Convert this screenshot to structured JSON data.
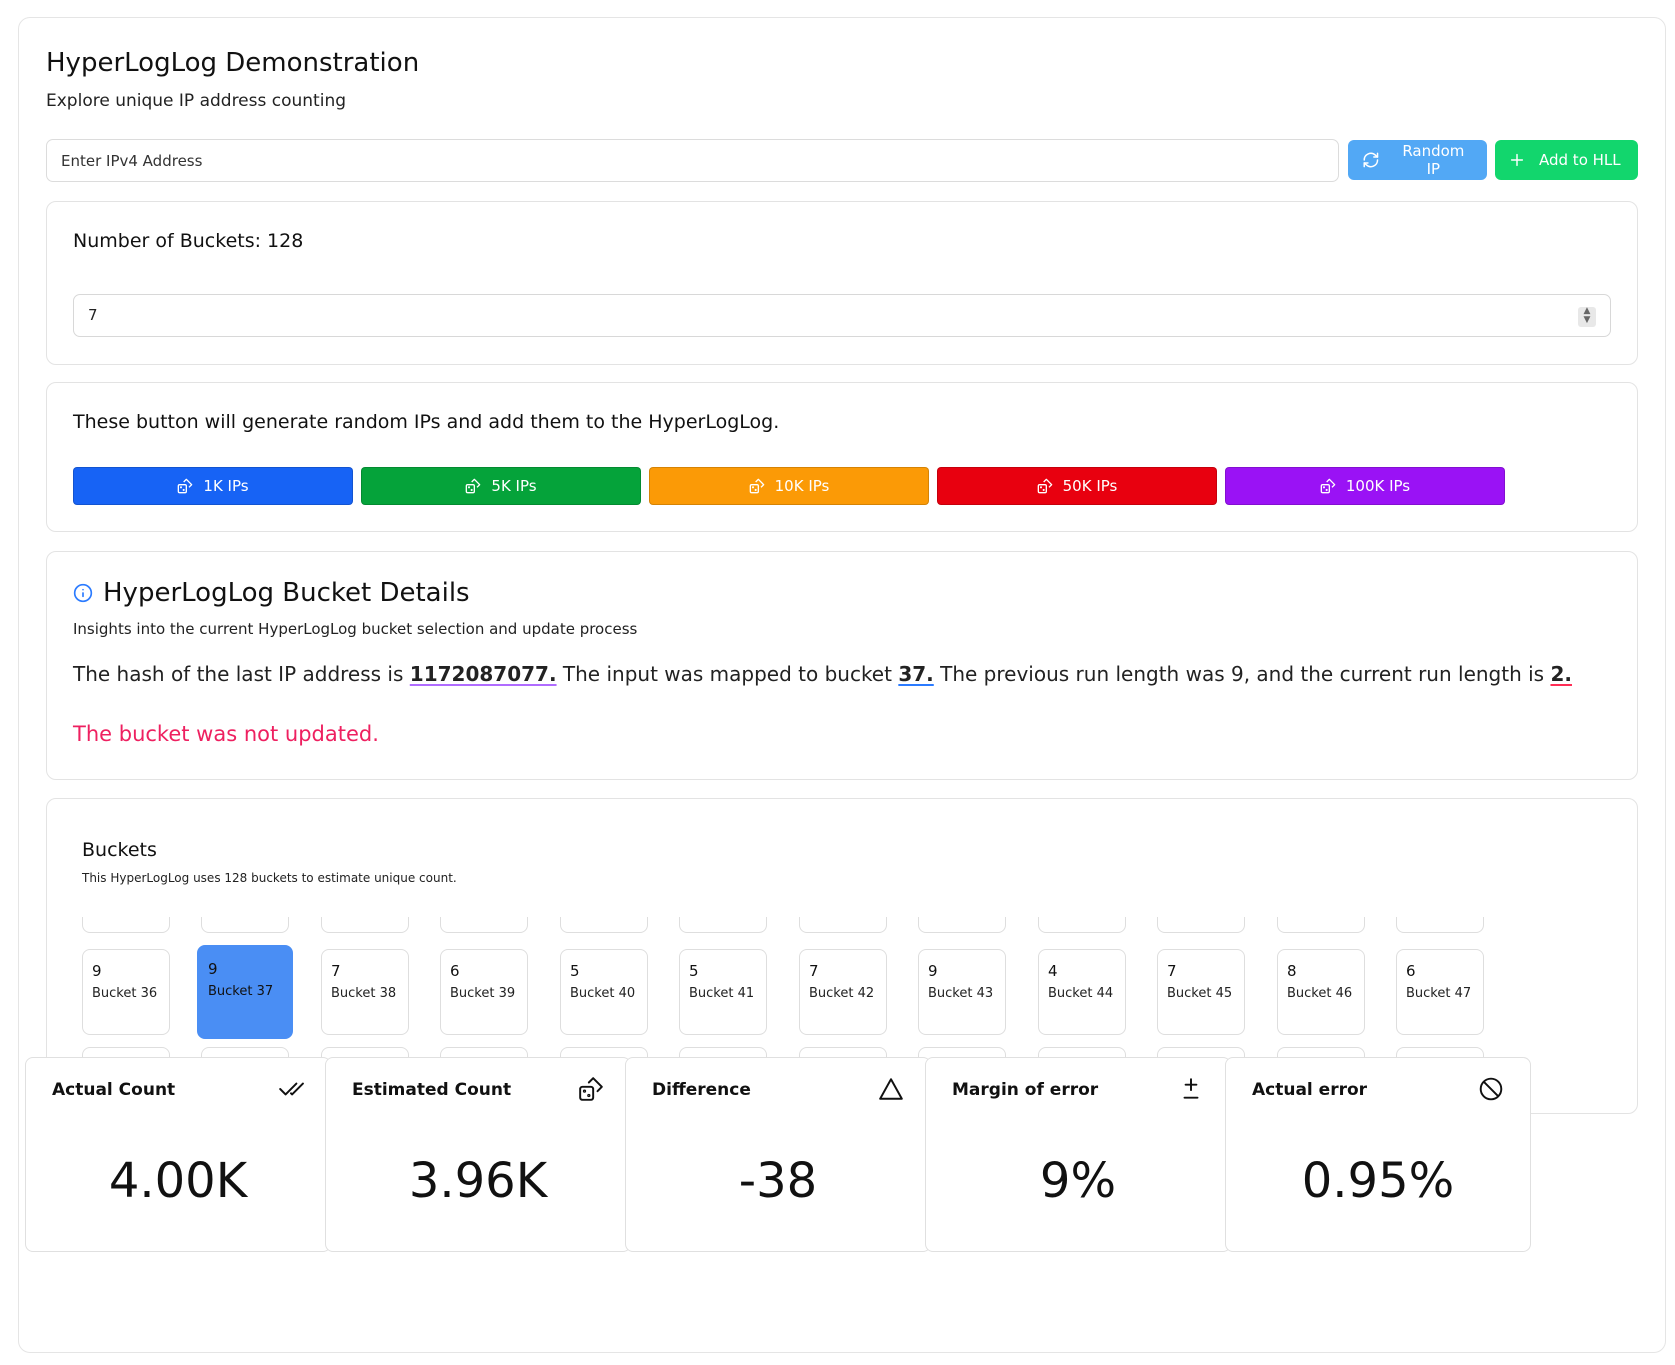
{
  "header": {
    "title": "HyperLogLog Demonstration",
    "subtitle": "Explore unique IP address counting"
  },
  "ip_input": {
    "placeholder": "Enter IPv4 Address"
  },
  "buttons": {
    "random_ip": "Random IP",
    "add_to_hll": "Add to HLL"
  },
  "bucket_config": {
    "heading": "Number of Buckets: 128",
    "value": "7"
  },
  "generator": {
    "heading": "These button will generate random IPs and add them to the HyperLogLog.",
    "buttons": [
      {
        "label": "1K IPs",
        "color": "#1763f5"
      },
      {
        "label": "5K IPs",
        "color": "#05a33a"
      },
      {
        "label": "10K IPs",
        "color": "#fb9a06"
      },
      {
        "label": "50K IPs",
        "color": "#e8000f"
      },
      {
        "label": "100K IPs",
        "color": "#9a12f5"
      }
    ]
  },
  "details": {
    "title": "HyperLogLog Bucket Details",
    "subtitle": "Insights into the current HyperLogLog bucket selection and update process",
    "text1": "The hash of the last IP address is ",
    "hash": "1172087077.",
    "text2": " The input was mapped to bucket ",
    "bucket": "37.",
    "text3": " The previous run length was 9, and the current run length is ",
    "run_length": "2.",
    "status": "The bucket was not updated.",
    "status_color": "#ee2060"
  },
  "buckets": {
    "heading": "Buckets",
    "subtitle": "This HyperLogLog uses 128 buckets to estimate unique count.",
    "selected_index": 1,
    "items": [
      {
        "value": "9",
        "label": "Bucket 36"
      },
      {
        "value": "9",
        "label": "Bucket 37"
      },
      {
        "value": "7",
        "label": "Bucket 38"
      },
      {
        "value": "6",
        "label": "Bucket 39"
      },
      {
        "value": "5",
        "label": "Bucket 40"
      },
      {
        "value": "5",
        "label": "Bucket 41"
      },
      {
        "value": "7",
        "label": "Bucket 42"
      },
      {
        "value": "9",
        "label": "Bucket 43"
      },
      {
        "value": "4",
        "label": "Bucket 44"
      },
      {
        "value": "7",
        "label": "Bucket 45"
      },
      {
        "value": "8",
        "label": "Bucket 46"
      },
      {
        "value": "6",
        "label": "Bucket 47"
      }
    ]
  },
  "stats": [
    {
      "label": "Actual Count",
      "value": "4.00K",
      "icon": "double-check-icon"
    },
    {
      "label": "Estimated Count",
      "value": "3.96K",
      "icon": "dice-icon"
    },
    {
      "label": "Difference",
      "value": "-38",
      "icon": "triangle-icon"
    },
    {
      "label": "Margin of error",
      "value": "9%",
      "icon": "plus-minus-icon"
    },
    {
      "label": "Actual error",
      "value": "0.95%",
      "icon": "prohibited-icon"
    }
  ]
}
